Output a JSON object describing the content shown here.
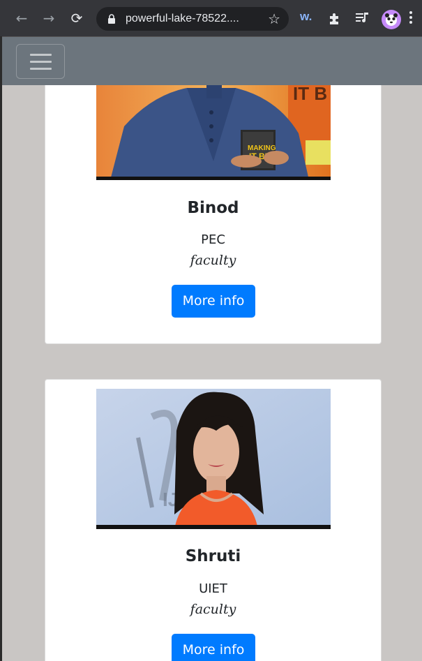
{
  "browser": {
    "url": "powerful-lake-78522....",
    "back_icon": "←",
    "forward_icon": "→",
    "reload_icon": "⟳",
    "star_icon": "☆",
    "extension_w_label": "w."
  },
  "navbar": {
    "brand_color": "#6c757d",
    "toggler_icon": "hamburger-menu-icon"
  },
  "people": [
    {
      "name": "Binod",
      "college": "PEC",
      "role": "faculty",
      "button_label": "More info"
    },
    {
      "name": "Shruti",
      "college": "UIET",
      "role": "faculty",
      "button_label": "More info"
    }
  ],
  "colors": {
    "primary_button": "#007bff",
    "page_background": "#c9c6c4"
  }
}
